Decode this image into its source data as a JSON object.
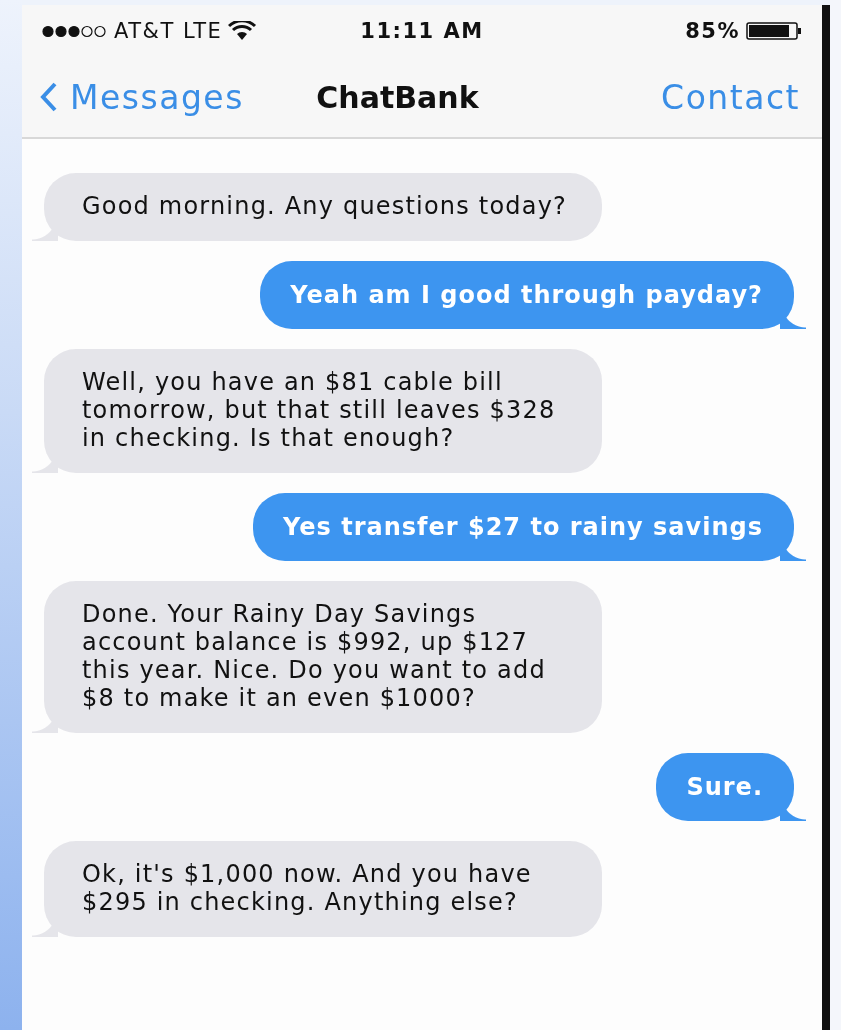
{
  "status_bar": {
    "carrier": "AT&T LTE",
    "time": "11:11 AM",
    "battery": "85%"
  },
  "nav_bar": {
    "back": "Messages",
    "title": "ChatBank",
    "action": "Contact"
  },
  "messages": [
    {
      "kind": "incoming",
      "text": "Good morning. Any questions today?"
    },
    {
      "kind": "outgoing",
      "text": "Yeah am I good through payday?"
    },
    {
      "kind": "incoming",
      "text": "Well, you have an $81 cable bill tomorrow, but that still leaves $328 in checking. Is that enough?"
    },
    {
      "kind": "outgoing",
      "text": "Yes transfer $27 to rainy savings"
    },
    {
      "kind": "incoming",
      "text": "Done. Your Rainy Day Savings account balance is $992, up $127 this year. Nice. Do you want to add $8 to make it an even $1000?"
    },
    {
      "kind": "outgoing",
      "text": "Sure."
    },
    {
      "kind": "incoming",
      "text": "Ok, it's $1,000 now. And you have $295 in checking. Anything else?"
    }
  ]
}
